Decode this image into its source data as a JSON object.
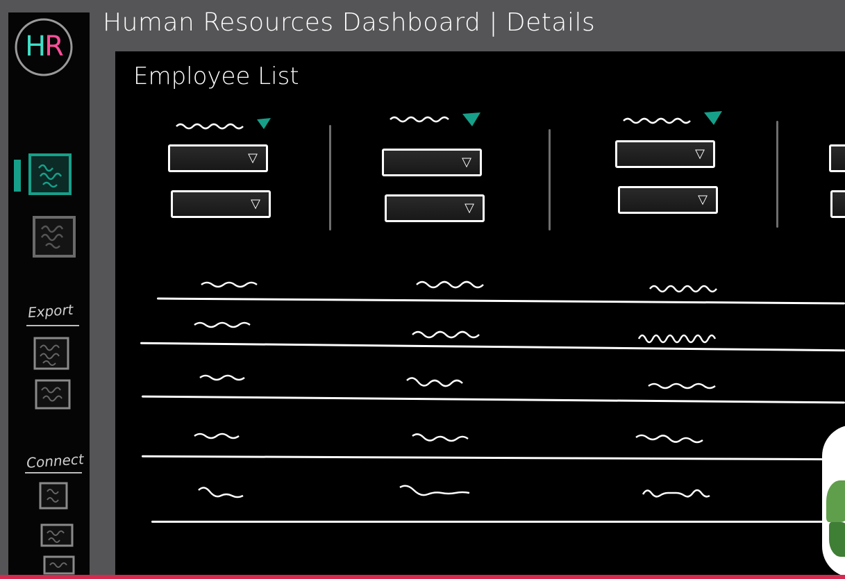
{
  "header": {
    "title": "Human Resources Dashboard | Details"
  },
  "logo": {
    "h": "H",
    "r": "R"
  },
  "sidebar": {
    "nav_items": [
      {
        "name": "nav-item-active",
        "active": true
      },
      {
        "name": "nav-item"
      }
    ],
    "export_label": "Export",
    "export_items": 2,
    "connect_label": "Connect",
    "connect_items": 3
  },
  "main": {
    "title": "Employee List",
    "filters": [
      {
        "caret": "▽"
      },
      {
        "caret": "▽"
      },
      {
        "caret": "▽"
      },
      {
        "caret": "▽"
      }
    ],
    "rows": 5
  },
  "colors": {
    "accent": "#16a08a",
    "logo_h": "#3fe0c8",
    "logo_r": "#ff4f9a",
    "bottom_bar": "#d42a4f"
  }
}
